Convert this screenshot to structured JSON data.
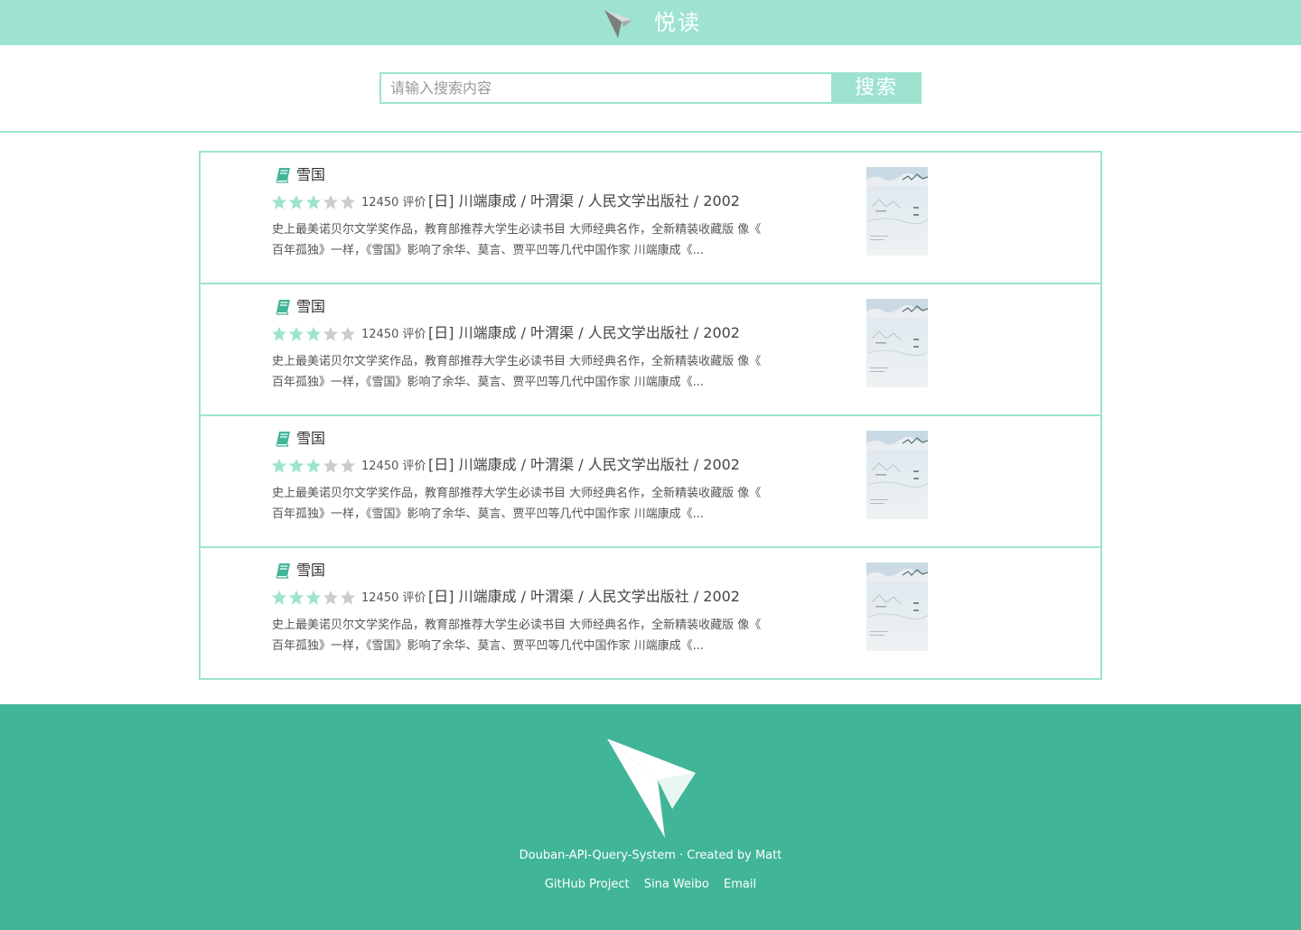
{
  "header": {
    "brand": "悦读",
    "logo_icon": "paper-plane-icon"
  },
  "search": {
    "placeholder": "请输入搜索内容",
    "value": "",
    "button_label": "搜索"
  },
  "colors": {
    "accent_light": "#9de3d0",
    "accent_dark": "#41b597",
    "star_on": "#9de3d0",
    "star_off": "#cccccc"
  },
  "results": [
    {
      "icon": "book-icon",
      "title": "雪国",
      "rating_stars": 3,
      "rating_max": 5,
      "rating_count": "12450 评价",
      "meta": "[日] 川端康成 / 叶渭渠 / 人民文学出版社 / 2002",
      "desc_line1": "史上最美诺贝尔文学奖作品，教育部推荐大学生必读书目 大师经典名作，全新精装收藏版 像《",
      "desc_line2": "百年孤独》一样，《雪国》影响了余华、莫言、贾平凹等几代中国作家 川端康成《..."
    },
    {
      "icon": "book-icon",
      "title": "雪国",
      "rating_stars": 3,
      "rating_max": 5,
      "rating_count": "12450 评价",
      "meta": "[日] 川端康成 / 叶渭渠 / 人民文学出版社 / 2002",
      "desc_line1": "史上最美诺贝尔文学奖作品，教育部推荐大学生必读书目 大师经典名作，全新精装收藏版 像《",
      "desc_line2": "百年孤独》一样，《雪国》影响了余华、莫言、贾平凹等几代中国作家 川端康成《..."
    },
    {
      "icon": "book-icon",
      "title": "雪国",
      "rating_stars": 3,
      "rating_max": 5,
      "rating_count": "12450 评价",
      "meta": "[日] 川端康成 / 叶渭渠 / 人民文学出版社 / 2002",
      "desc_line1": "史上最美诺贝尔文学奖作品，教育部推荐大学生必读书目 大师经典名作，全新精装收藏版 像《",
      "desc_line2": "百年孤独》一样，《雪国》影响了余华、莫言、贾平凹等几代中国作家 川端康成《..."
    },
    {
      "icon": "book-icon",
      "title": "雪国",
      "rating_stars": 3,
      "rating_max": 5,
      "rating_count": "12450 评价",
      "meta": "[日] 川端康成 / 叶渭渠 / 人民文学出版社 / 2002",
      "desc_line1": "史上最美诺贝尔文学奖作品，教育部推荐大学生必读书目 大师经典名作，全新精装收藏版 像《",
      "desc_line2": "百年孤独》一样，《雪国》影响了余华、莫言、贾平凹等几代中国作家 川端康成《..."
    }
  ],
  "footer": {
    "logo_icon": "paper-plane-icon",
    "credit": "Douban-API-Query-System · Created by Matt",
    "links": [
      "GitHub Project",
      "Sina Weibo",
      "Email"
    ]
  }
}
